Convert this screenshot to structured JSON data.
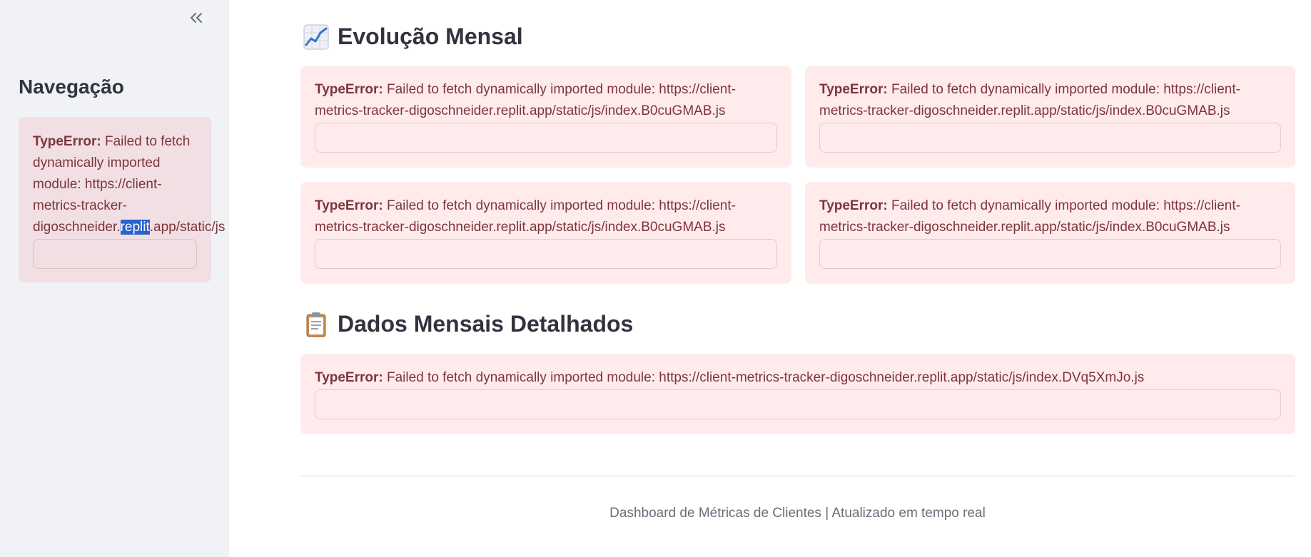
{
  "sidebar": {
    "collapse_icon": "double-chevron-left-icon",
    "title": "Navegação",
    "error": {
      "label": "TypeError:",
      "lines": [
        " Failed to fetch",
        "dynamically imported",
        "module: https://client-",
        "metrics-tracker-"
      ],
      "last_line_before": "digoschneider.",
      "last_line_selected": "replit",
      "last_line_after": ".app/static/js"
    }
  },
  "main": {
    "evolution_section": {
      "icon": "chart-increasing-icon",
      "title": "Evolução Mensal"
    },
    "chart_errors": [
      {
        "label": "TypeError:",
        "message": " Failed to fetch dynamically imported module: https://client-metrics-tracker-digoschneider.replit.app/static/js/index.B0cuGMAB.js"
      },
      {
        "label": "TypeError:",
        "message": " Failed to fetch dynamically imported module: https://client-metrics-tracker-digoschneider.replit.app/static/js/index.B0cuGMAB.js"
      },
      {
        "label": "TypeError:",
        "message": " Failed to fetch dynamically imported module: https://client-metrics-tracker-digoschneider.replit.app/static/js/index.B0cuGMAB.js"
      },
      {
        "label": "TypeError:",
        "message": " Failed to fetch dynamically imported module: https://client-metrics-tracker-digoschneider.replit.app/static/js/index.B0cuGMAB.js"
      }
    ],
    "details_section": {
      "icon": "clipboard-icon",
      "title": "Dados Mensais Detalhados"
    },
    "table_error": {
      "label": "TypeError:",
      "message": " Failed to fetch dynamically imported module: https://client-metrics-tracker-digoschneider.replit.app/static/js/index.DVq5XmJo.js"
    },
    "footer": "Dashboard de Métricas de Clientes | Atualizado em tempo real"
  },
  "colors": {
    "sidebar_bg": "#f0f2f6",
    "error_bg": "#ffebec",
    "error_text": "#7d353b",
    "selection": "#2962cc"
  }
}
